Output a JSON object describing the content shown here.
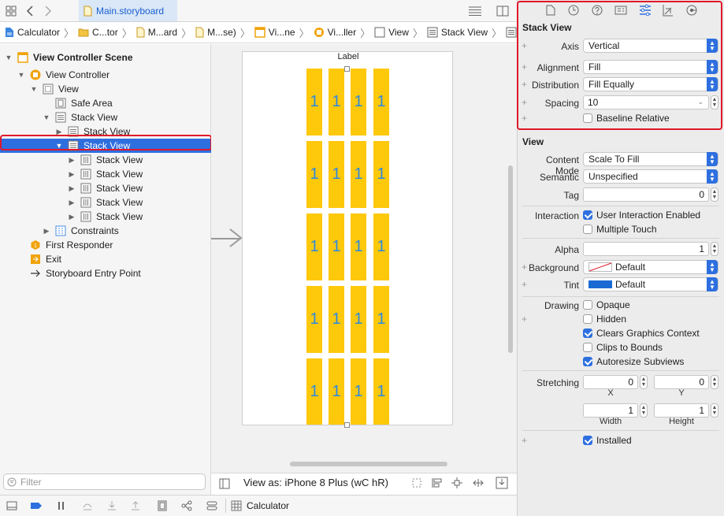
{
  "editor": {
    "file_tab": "Main.storyboard"
  },
  "breadcrumb": [
    "Calculator",
    "C...tor",
    "M...ard",
    "M...se)",
    "Vi...ne",
    "Vi...ller",
    "View",
    "Stack View",
    "Stack View"
  ],
  "outline": {
    "scene": "View Controller Scene",
    "view_controller": "View Controller",
    "view": "View",
    "safe_area": "Safe Area",
    "stack_view": "Stack View",
    "child_stack": "Stack View",
    "selected_stack": "Stack View",
    "row_stacks": [
      "Stack View",
      "Stack View",
      "Stack View",
      "Stack View",
      "Stack View"
    ],
    "constraints": "Constraints",
    "first_responder": "First Responder",
    "exit": "Exit",
    "entry_point": "Storyboard Entry Point",
    "filter_placeholder": "Filter"
  },
  "canvas": {
    "label": "Label",
    "cell_value": "1",
    "view_as": "View as: iPhone 8 Plus (wC hR)"
  },
  "debug_bar": {
    "scheme": "Calculator"
  },
  "inspector": {
    "stack_section": "Stack View",
    "axis_label": "Axis",
    "axis_value": "Vertical",
    "alignment_label": "Alignment",
    "alignment_value": "Fill",
    "distribution_label": "Distribution",
    "distribution_value": "Fill Equally",
    "spacing_label": "Spacing",
    "spacing_value": "10",
    "baseline_relative": "Baseline Relative",
    "view_section": "View",
    "content_mode_label": "Content Mode",
    "content_mode_value": "Scale To Fill",
    "semantic_label": "Semantic",
    "semantic_value": "Unspecified",
    "tag_label": "Tag",
    "tag_value": "0",
    "interaction_label": "Interaction",
    "user_interaction": "User Interaction Enabled",
    "multiple_touch": "Multiple Touch",
    "alpha_label": "Alpha",
    "alpha_value": "1",
    "background_label": "Background",
    "background_value": "Default",
    "tint_label": "Tint",
    "tint_value": "Default",
    "tint_color": "#1a6ad4",
    "drawing_label": "Drawing",
    "opaque": "Opaque",
    "hidden": "Hidden",
    "clears_graphics": "Clears Graphics Context",
    "clips_to_bounds": "Clips to Bounds",
    "autoresize": "Autoresize Subviews",
    "stretching_label": "Stretching",
    "stretch_x": "0",
    "stretch_y": "0",
    "stretch_x_label": "X",
    "stretch_y_label": "Y",
    "stretch_w": "1",
    "stretch_h": "1",
    "width_label": "Width",
    "height_label": "Height",
    "installed": "Installed"
  },
  "colors": {
    "accent": "#2e6fe0",
    "highlight_outline": "#e0182a",
    "cell_fill": "#fec80b",
    "cell_text": "#2a8ae0"
  }
}
